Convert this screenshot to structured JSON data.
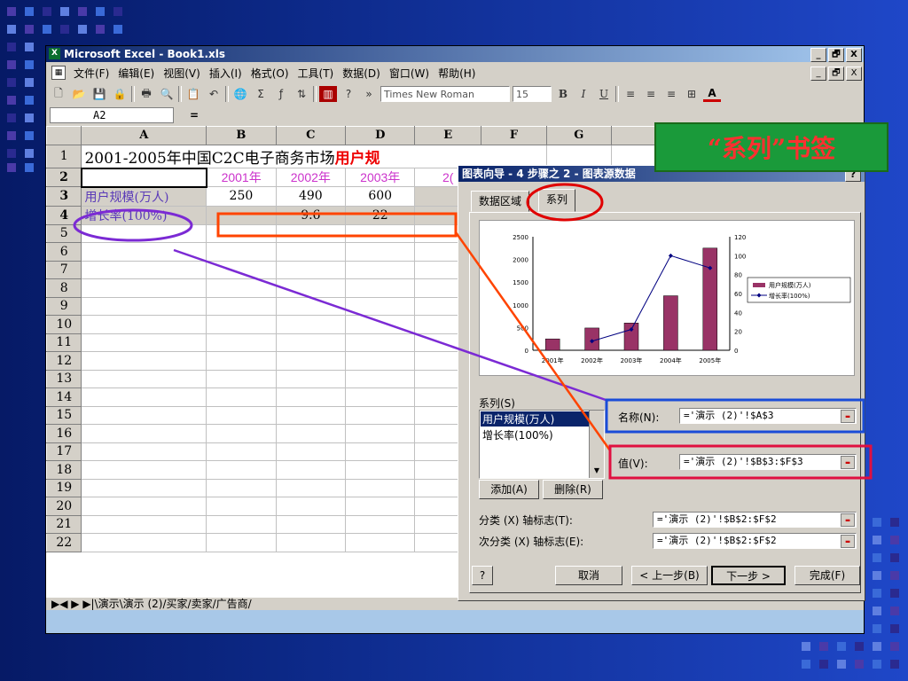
{
  "window": {
    "title": "Microsoft Excel - Book1.xls",
    "controls": [
      "_",
      "🗗",
      "X"
    ]
  },
  "menu": [
    "文件(F)",
    "编辑(E)",
    "视图(V)",
    "插入(I)",
    "格式(O)",
    "工具(T)",
    "数据(D)",
    "窗口(W)",
    "帮助(H)"
  ],
  "toolbar": {
    "font": "Times New Roman",
    "size": "15",
    "bold": "B",
    "italic": "I",
    "underline": "U",
    "font_color": "A"
  },
  "formula": {
    "cell": "A2",
    "eq": "="
  },
  "sheet": {
    "columns": [
      "A",
      "B",
      "C",
      "D",
      "E",
      "F",
      "G"
    ],
    "row1": {
      "title_a": "2001-2005年中国C2C电子商务市场",
      "title_b": "用户规"
    },
    "years": [
      "2001年",
      "2002年",
      "2003年",
      "2("
    ],
    "row3": {
      "label": "用户规模(万人)",
      "values": [
        "250",
        "490",
        "600"
      ]
    },
    "row4": {
      "label": "增长率(100%)",
      "values": [
        "",
        "9.6",
        "22"
      ]
    },
    "row_numbers": [
      "1",
      "2",
      "3",
      "4",
      "5",
      "6",
      "7",
      "8",
      "9",
      "10",
      "11",
      "12",
      "13",
      "14",
      "15",
      "16",
      "17",
      "18",
      "19",
      "20",
      "21",
      "22"
    ],
    "tabs": "▶◀ ▶ ▶|\\演示\\演示 (2)/买家/卖家/广告商/"
  },
  "dialog": {
    "title": "图表向导 - 4 步骤之 2 - 图表源数据",
    "help": "?",
    "tabs": [
      "数据区域",
      "系列"
    ],
    "series_label": "系列(S)",
    "series_items": [
      "用户规模(万人)",
      "增长率(100%)"
    ],
    "name_label": "名称(N):",
    "name_ref": "='演示 (2)'!$A$3",
    "value_label": "值(V):",
    "value_ref": "='演示 (2)'!$B$3:$F$3",
    "add": "添加(A)",
    "delete": "删除(R)",
    "category_label": "分类 (X) 轴标志(T):",
    "category_ref": "='演示 (2)'!$B$2:$F$2",
    "subcat_label": "次分类 (X) 轴标志(E):",
    "subcat_ref": "='演示 (2)'!$B$2:$F$2",
    "cancel": "取消",
    "back": "< 上一步(B)",
    "next": "下一步 >",
    "finish": "完成(F)",
    "help_btn": "?"
  },
  "annotation": "“系列”书签",
  "chart_data": {
    "type": "bar",
    "categories": [
      "2001年",
      "2002年",
      "2003年",
      "2004年",
      "2005年"
    ],
    "series": [
      {
        "name": "用户规模(万人)",
        "type": "bar",
        "axis": "left",
        "values": [
          250,
          490,
          600,
          1200,
          2250
        ],
        "color": "#993366"
      },
      {
        "name": "增长率(100%)",
        "type": "line",
        "axis": "right",
        "values": [
          null,
          9.6,
          22,
          100,
          87
        ],
        "color": "#000080"
      }
    ],
    "left_ticks": [
      "0",
      "500",
      "1000",
      "1500",
      "2000",
      "2500"
    ],
    "right_ticks": [
      "0",
      "20",
      "40",
      "60",
      "80",
      "100",
      "120"
    ],
    "ylim_left": [
      0,
      2500
    ],
    "ylim_right": [
      0,
      120
    ],
    "legend": "right"
  }
}
